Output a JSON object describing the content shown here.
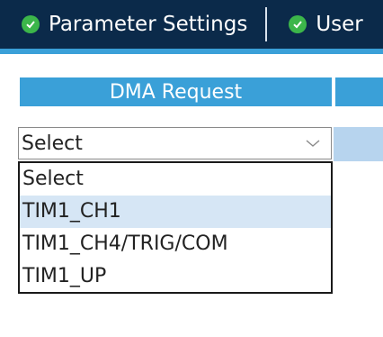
{
  "tabs": [
    {
      "label": "Parameter Settings",
      "icon": "check-circle-icon"
    },
    {
      "label": "User",
      "icon": "check-circle-icon"
    }
  ],
  "table": {
    "header": "DMA Request"
  },
  "select": {
    "value": "Select",
    "icon": "chevron-down-icon"
  },
  "dropdown": {
    "options": [
      "Select",
      "TIM1_CH1",
      "TIM1_CH4/TRIG/COM",
      "TIM1_UP"
    ],
    "highlighted": "TIM1_CH1"
  },
  "colors": {
    "tabbar_bg": "#0b2a4a",
    "accent": "#3aa0d8",
    "highlight": "#d6e6f5",
    "check": "#3cb64a"
  }
}
